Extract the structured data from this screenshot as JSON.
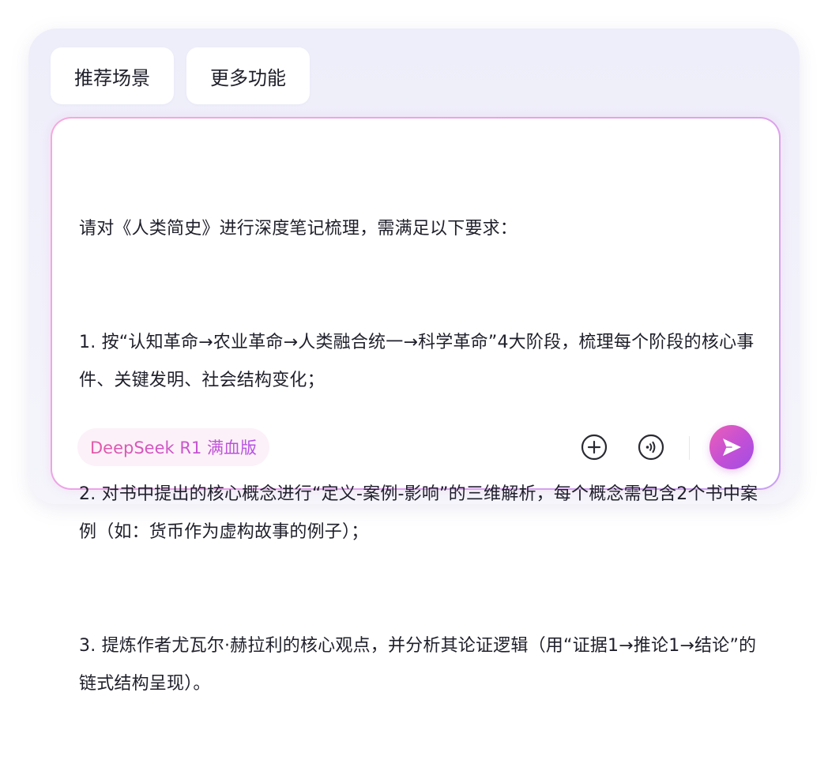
{
  "chips": {
    "scenes_label": "推荐场景",
    "more_label": "更多功能"
  },
  "prompt": {
    "lines": [
      "请对《人类简史》进行深度笔记梳理，需满足以下要求：",
      "1. 按“认知革命→农业革命→人类融合统一→科学革命”4大阶段，梳理每个阶段的核心事件、关键发明、社会结构变化；",
      "2. 对书中提出的核心概念进行“定义-案例-影响”的三维解析，每个概念需包含2个书中案例（如：货币作为虚构故事的例子）；",
      "3. 提炼作者尤瓦尔·赫拉利的核心观点，并分析其论证逻辑（用“证据1→推论1→结论”的链式结构呈现）。"
    ]
  },
  "toolbar": {
    "model_label": "DeepSeek R1 满血版",
    "plus_icon": "plus-circle-icon",
    "voice_icon": "voice-icon",
    "send_icon": "send-icon"
  },
  "colors": {
    "accent_start": "#ec5fb6",
    "accent_end": "#a04ee6",
    "text": "#1f1f2b"
  }
}
